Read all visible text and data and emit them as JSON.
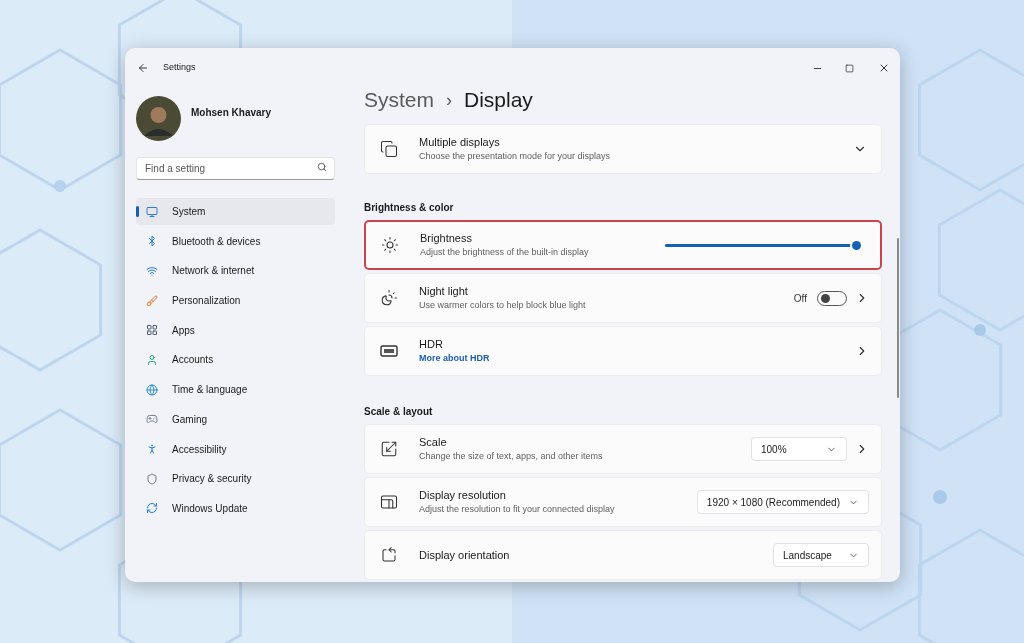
{
  "window": {
    "title": "Settings"
  },
  "profile": {
    "name": "Mohsen Khavary"
  },
  "search": {
    "placeholder": "Find a setting"
  },
  "sidebar": {
    "items": [
      {
        "label": "System",
        "selected": true
      },
      {
        "label": "Bluetooth & devices",
        "selected": false
      },
      {
        "label": "Network & internet",
        "selected": false
      },
      {
        "label": "Personalization",
        "selected": false
      },
      {
        "label": "Apps",
        "selected": false
      },
      {
        "label": "Accounts",
        "selected": false
      },
      {
        "label": "Time & language",
        "selected": false
      },
      {
        "label": "Gaming",
        "selected": false
      },
      {
        "label": "Accessibility",
        "selected": false
      },
      {
        "label": "Privacy & security",
        "selected": false
      },
      {
        "label": "Windows Update",
        "selected": false
      }
    ]
  },
  "breadcrumb": {
    "parent": "System",
    "separator": "›",
    "current": "Display"
  },
  "sections": [
    {
      "rows": [
        {
          "kind": "expand",
          "title": "Multiple displays",
          "subtitle": "Choose the presentation mode for your displays",
          "highlighted": false
        }
      ]
    },
    {
      "heading": "Brightness & color",
      "rows": [
        {
          "kind": "slider",
          "title": "Brightness",
          "subtitle": "Adjust the brightness of the built-in display",
          "level": 1,
          "highlighted": true
        },
        {
          "kind": "toggle",
          "title": "Night light",
          "subtitle": "Use warmer colors to help block blue light",
          "state_label": "Off",
          "on": false,
          "highlighted": false
        },
        {
          "kind": "link",
          "title": "HDR",
          "link": "More about HDR",
          "highlighted": false
        }
      ]
    },
    {
      "heading": "Scale & layout",
      "rows": [
        {
          "kind": "dropdown",
          "title": "Scale",
          "subtitle": "Change the size of text, apps, and other items",
          "value": "100%",
          "chevron": true,
          "highlighted": false
        },
        {
          "kind": "dropdown",
          "title": "Display resolution",
          "subtitle": "Adjust the resolution to fit your connected display",
          "value": "1920 × 1080 (Recommended)",
          "chevron": false,
          "highlighted": false
        },
        {
          "kind": "dropdown",
          "title": "Display orientation",
          "value": "Landscape",
          "chevron": false,
          "highlighted": false
        }
      ]
    }
  ]
}
